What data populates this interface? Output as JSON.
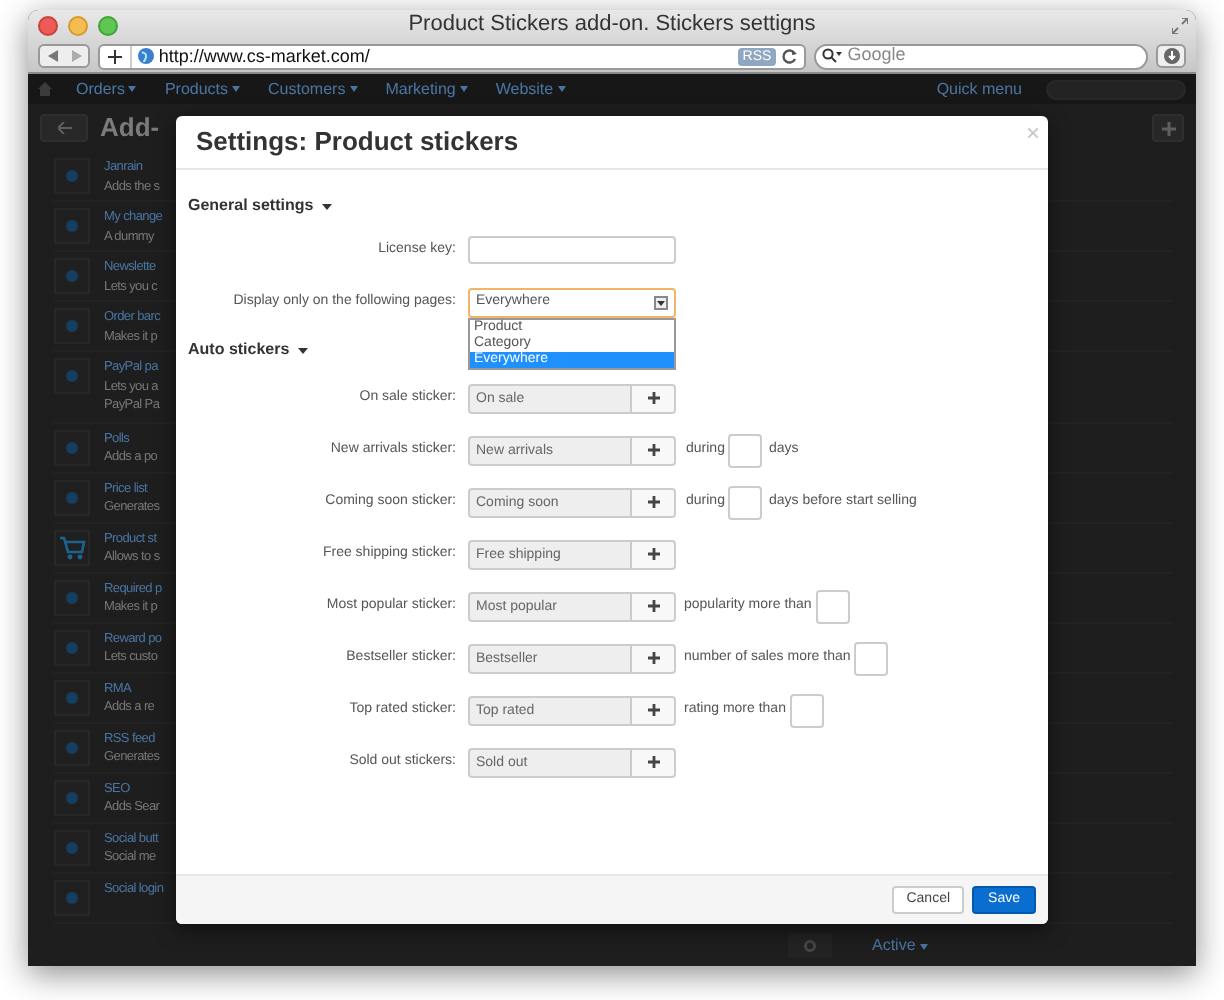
{
  "browser": {
    "title": "Product Stickers add-on. Stickers settigns",
    "url": "http://www.cs-market.com/",
    "rss": "RSS",
    "search_placeholder": "Google"
  },
  "backend": {
    "nav": [
      "Orders",
      "Products",
      "Customers",
      "Marketing",
      "Website"
    ],
    "quick_menu": "Quick menu",
    "page_title": "Add-",
    "addons": [
      {
        "title": "Janrain",
        "desc": "Adds the s",
        "kind": "dot"
      },
      {
        "title": "My change",
        "desc": "A dummy",
        "kind": "dot"
      },
      {
        "title": "Newslette",
        "desc": "Lets you c",
        "kind": "dot"
      },
      {
        "title": "Order barc",
        "desc": "Makes it p",
        "kind": "dot"
      },
      {
        "title": "PayPal pa",
        "desc": "Lets you a",
        "desc2": "PayPal Pa",
        "kind": "dot"
      },
      {
        "title": "Polls",
        "desc": "Adds a po",
        "kind": "dot"
      },
      {
        "title": "Price list",
        "desc": "Generates",
        "kind": "dot"
      },
      {
        "title": "Product st",
        "desc": "Allows to s",
        "kind": "cart"
      },
      {
        "title": "Required p",
        "desc": "Makes it p",
        "kind": "dot"
      },
      {
        "title": "Reward po",
        "desc": "Lets custo",
        "kind": "dot"
      },
      {
        "title": "RMA",
        "desc": "Adds a re",
        "kind": "dot"
      },
      {
        "title": "RSS feed",
        "desc": "Generates",
        "kind": "dot"
      },
      {
        "title": "SEO",
        "desc": "Adds Sear",
        "kind": "dot"
      },
      {
        "title": "Social butt",
        "desc": "Social me",
        "kind": "dot"
      },
      {
        "title": "Social login",
        "kind": "dot"
      }
    ],
    "status": "Active"
  },
  "modal": {
    "title": "Settings: Product stickers",
    "general": {
      "title": "General settings",
      "license_label": "License key:",
      "pages_label": "Display only on the following pages:",
      "pages_value": "Everywhere",
      "expanded": true,
      "options": [
        {
          "label": "Product",
          "selected": false
        },
        {
          "label": "Category",
          "selected": false
        },
        {
          "label": "Everywhere",
          "selected": true
        }
      ]
    },
    "auto": {
      "title": "Auto stickers",
      "rows": [
        {
          "label": "On sale sticker:",
          "value": "On sale",
          "kind": "plain"
        },
        {
          "label": "New arrivals sticker:",
          "value": "New arrivals",
          "kind": "during",
          "before": "during",
          "after": "days"
        },
        {
          "label": "Coming soon sticker:",
          "value": "Coming soon",
          "kind": "during",
          "before": "during",
          "after": "days before start selling"
        },
        {
          "label": "Free shipping sticker:",
          "value": "Free shipping",
          "kind": "plain"
        },
        {
          "label": "Most popular sticker:",
          "value": "Most popular",
          "kind": "threshold",
          "before": "popularity more than"
        },
        {
          "label": "Bestseller sticker:",
          "value": "Bestseller",
          "kind": "threshold",
          "before": "number of sales more than"
        },
        {
          "label": "Top rated sticker:",
          "value": "Top rated",
          "kind": "threshold",
          "before": "rating more than"
        },
        {
          "label": "Sold out stickers:",
          "value": "Sold out",
          "kind": "plain"
        }
      ]
    },
    "cancel": "Cancel",
    "save": "Save"
  }
}
